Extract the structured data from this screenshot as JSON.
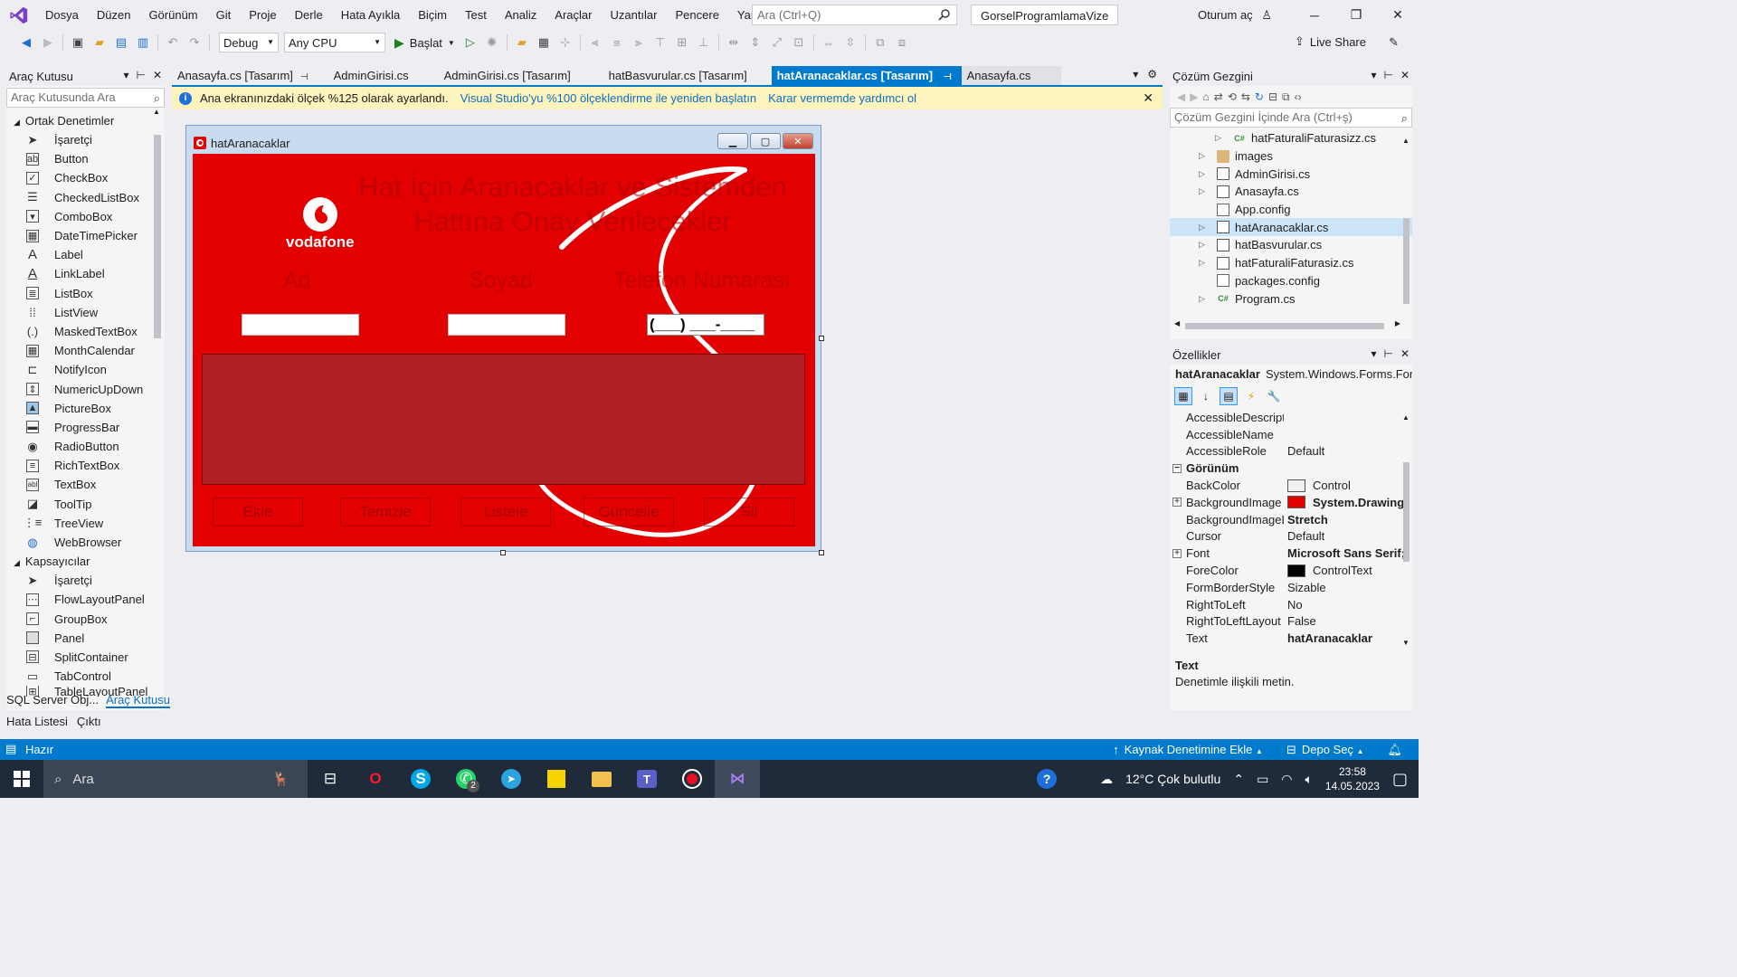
{
  "menubar": {
    "items": [
      "Dosya",
      "Düzen",
      "Görünüm",
      "Git",
      "Proje",
      "Derle",
      "Hata Ayıkla",
      "Biçim",
      "Test",
      "Analiz",
      "Araçlar",
      "Uzantılar",
      "Pencere",
      "Yardım"
    ],
    "search_placeholder": "Ara (Ctrl+Q)",
    "solution_name": "GorselProgramlamaVize",
    "signin": "Oturum aç"
  },
  "toolbar": {
    "config": "Debug",
    "platform": "Any CPU",
    "start_label": "Başlat",
    "liveshare": "Live Share"
  },
  "toolbox": {
    "title": "Araç Kutusu",
    "search_placeholder": "Araç Kutusunda Ara",
    "group_common": "Ortak Denetimler",
    "common_items": [
      "İşaretçi",
      "Button",
      "CheckBox",
      "CheckedListBox",
      "ComboBox",
      "DateTimePicker",
      "Label",
      "LinkLabel",
      "ListBox",
      "ListView",
      "MaskedTextBox",
      "MonthCalendar",
      "NotifyIcon",
      "NumericUpDown",
      "PictureBox",
      "ProgressBar",
      "RadioButton",
      "RichTextBox",
      "TextBox",
      "ToolTip",
      "TreeView",
      "WebBrowser"
    ],
    "group_containers": "Kapsayıcılar",
    "container_items": [
      "İşaretçi",
      "FlowLayoutPanel",
      "GroupBox",
      "Panel",
      "SplitContainer",
      "TabControl",
      "TableLayoutPanel"
    ],
    "tab_sql": "SQL Server Obj...",
    "tab_toolbox": "Araç Kutusu"
  },
  "doc_tabs": {
    "tabs": [
      "Anasayfa.cs [Tasarım]",
      "AdminGirisi.cs",
      "AdminGirisi.cs [Tasarım]",
      "hatBasvurular.cs [Tasarım]",
      "hatAranacaklar.cs [Tasarım]",
      "Anasayfa.cs"
    ]
  },
  "infobar": {
    "message": "Ana ekranınızdaki ölçek %125 olarak ayarlandı.",
    "link_restart": "Visual Studio'yu %100 ölçeklendirme ile yeniden başlatın",
    "link_help": "Karar vermemde yardımcı ol"
  },
  "form": {
    "title": "hatAranacaklar",
    "heading": "Hat İçin Aranacaklar ve Sistemden Hattına Onay Verilecekler",
    "logo_text": "vodafone",
    "label_ad": "Ad",
    "label_soyad": "Soyad",
    "label_telefon": "Telefon Numarası",
    "masked_phone": "(___) ___-____",
    "buttons": [
      "Ekle",
      "Temizle",
      "Listele",
      "Güncelle",
      "Sil"
    ]
  },
  "solution": {
    "title": "Çözüm Gezgini",
    "search_placeholder": "Çözüm Gezgini İçinde Ara (Ctrl+ş)",
    "items": [
      {
        "label": "hatFaturaliFaturasizz.cs",
        "kind": "cs",
        "level": 2
      },
      {
        "label": "images",
        "kind": "folder",
        "level": 1
      },
      {
        "label": "AdminGirisi.cs",
        "kind": "form",
        "level": 1
      },
      {
        "label": "Anasayfa.cs",
        "kind": "form",
        "level": 1
      },
      {
        "label": "App.config",
        "kind": "cfg",
        "level": 1
      },
      {
        "label": "hatAranacaklar.cs",
        "kind": "form",
        "level": 1
      },
      {
        "label": "hatBasvurular.cs",
        "kind": "form",
        "level": 1
      },
      {
        "label": "hatFaturaliFaturasiz.cs",
        "kind": "form",
        "level": 1
      },
      {
        "label": "packages.config",
        "kind": "cfg",
        "level": 1
      },
      {
        "label": "Program.cs",
        "kind": "cs",
        "level": 1
      }
    ]
  },
  "properties": {
    "title": "Özellikler",
    "object_name": "hatAranacaklar",
    "object_type": "System.Windows.Forms.Form",
    "rows": [
      {
        "name": "AccessibleDescriptic",
        "value": ""
      },
      {
        "name": "AccessibleName",
        "value": ""
      },
      {
        "name": "AccessibleRole",
        "value": "Default"
      },
      {
        "name": "Görünüm",
        "value": "",
        "category": true
      },
      {
        "name": "BackColor",
        "value": "Control",
        "swatch": "#f0f0f0"
      },
      {
        "name": "BackgroundImage",
        "value": "System.Drawing",
        "swatch": "#e30000",
        "bold": true,
        "expandable": true
      },
      {
        "name": "BackgroundImageLa",
        "value": "Stretch",
        "bold": true
      },
      {
        "name": "Cursor",
        "value": "Default"
      },
      {
        "name": "Font",
        "value": "Microsoft Sans Serif;",
        "bold": true,
        "expandable": true
      },
      {
        "name": "ForeColor",
        "value": "ControlText",
        "swatch": "#000000"
      },
      {
        "name": "FormBorderStyle",
        "value": "Sizable"
      },
      {
        "name": "RightToLeft",
        "value": "No"
      },
      {
        "name": "RightToLeftLayout",
        "value": "False"
      },
      {
        "name": "Text",
        "value": "hatAranacaklar",
        "bold": true
      }
    ],
    "desc_title": "Text",
    "desc_text": "Denetimle ilişkili metin."
  },
  "bottom_tabs": [
    "Hata Listesi",
    "Çıktı"
  ],
  "statusbar": {
    "ready": "Hazır",
    "source_control": "Kaynak Denetimine Ekle",
    "repo": "Depo Seç"
  },
  "taskbar": {
    "search": "Ara",
    "weather": "12°C  Çok bulutlu",
    "time": "23:58",
    "date": "14.05.2023",
    "whatsapp_badge": "2"
  },
  "colors": {
    "accent": "#007acc",
    "form_bg": "#e30000",
    "grid_bg": "#b01f24"
  }
}
